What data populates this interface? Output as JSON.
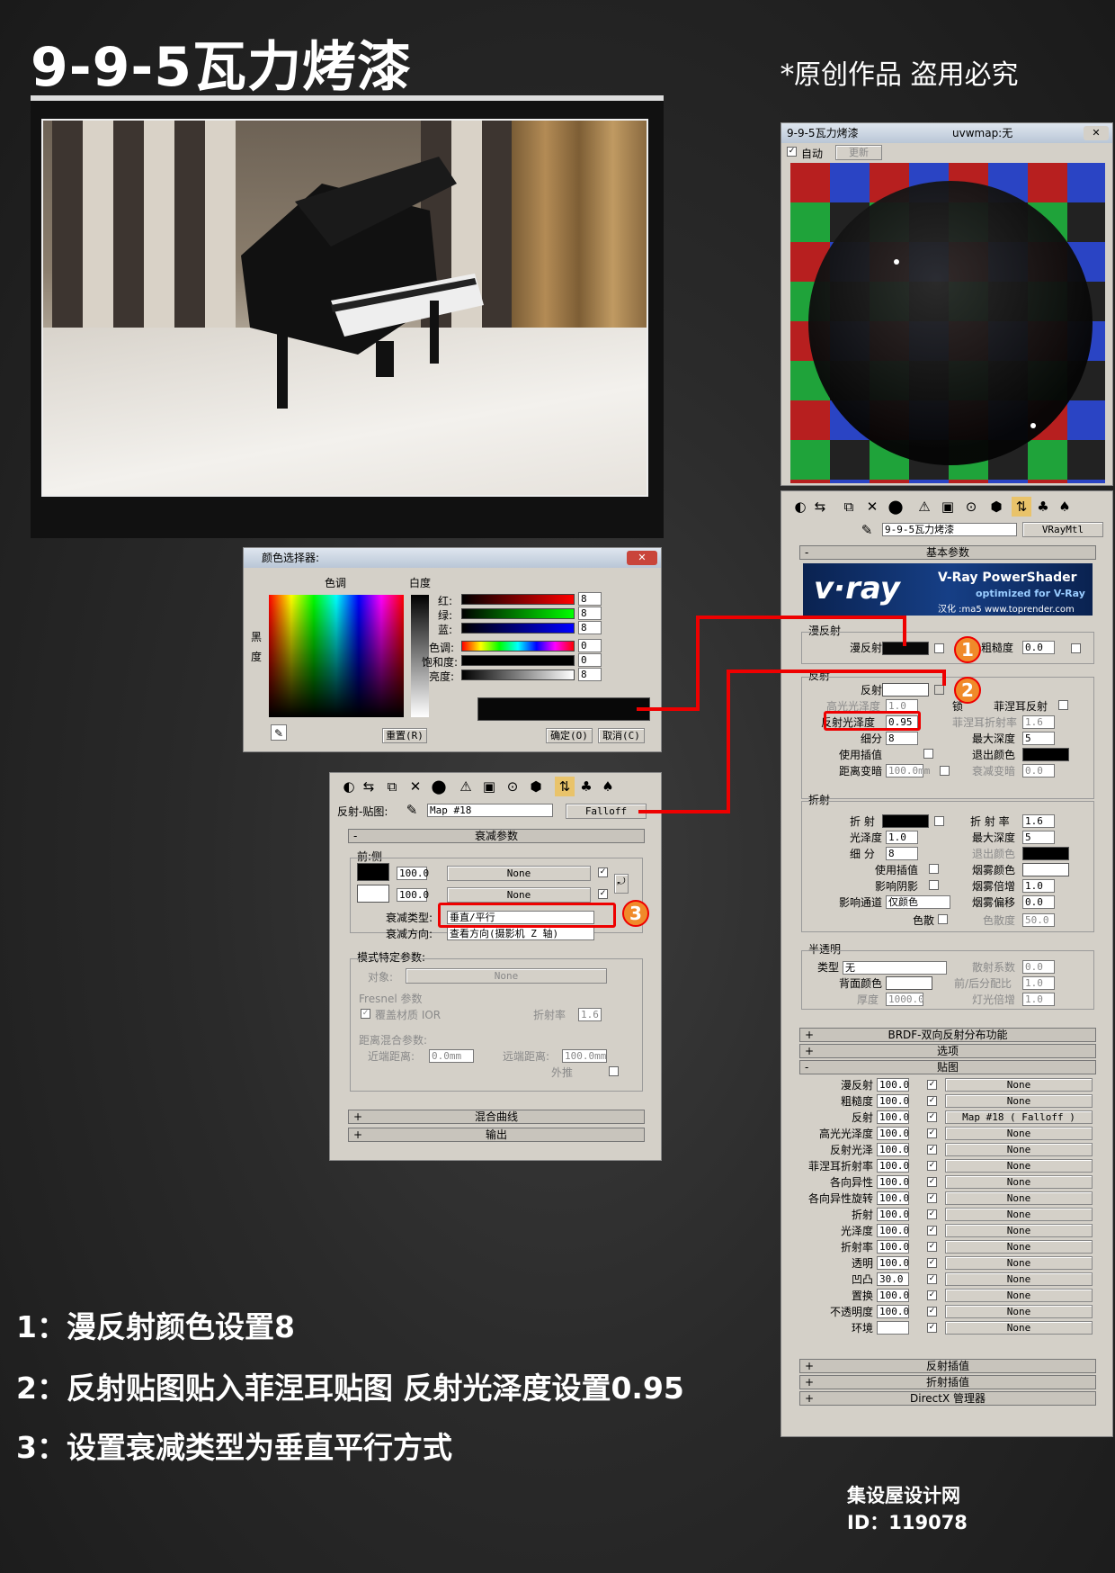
{
  "title": "9-9-5瓦力烤漆",
  "copyright": "*原创作品 盗用必究",
  "preview": {
    "title": "9-9-5瓦力烤漆",
    "map": "uvwmap:无",
    "auto": "自动",
    "update": "更新"
  },
  "color_picker": {
    "title": "颜色选择器:",
    "hue": "色调",
    "whiteness": "白度",
    "black": "黑",
    "degree": "度",
    "red": "红:",
    "green": "绿:",
    "blue": "蓝:",
    "hue2": "色调:",
    "sat": "饱和度:",
    "val": "亮度:",
    "red_v": "8",
    "green_v": "8",
    "blue_v": "8",
    "hue_v": "0",
    "sat_v": "0",
    "val_v": "8",
    "reset": "重置(R)",
    "ok": "确定(O)",
    "cancel": "取消(C)"
  },
  "falloff": {
    "label": "反射-贴图:",
    "map": "Map #18",
    "type": "Falloff",
    "rollout": "衰减参数",
    "front_side": "前:侧",
    "v1": "100.0",
    "v2": "100.0",
    "none": "None",
    "falloff_type_label": "衰减类型:",
    "falloff_type": "垂直/平行",
    "dir_label": "衰减方向:",
    "dir": "查看方向(摄影机 Z 轴)",
    "mode_params": "模式特定参数:",
    "object": "对象:",
    "fresnel": "Fresnel 参数",
    "override_ior": "覆盖材质 IOR",
    "ior": "折射率",
    "ior_v": "1.6",
    "dist_blend": "距离混合参数:",
    "near": "近端距离:",
    "near_v": "0.0mm",
    "far": "远端距离:",
    "far_v": "100.0mm",
    "extrap": "外推",
    "mix_curve": "混合曲线",
    "output": "输出"
  },
  "vray": {
    "material": "9-9-5瓦力烤漆",
    "type": "VRayMtl",
    "basic": "基本参数",
    "banner_logo": "v·ray",
    "banner_title": "V-Ray PowerShader",
    "banner_sub": "optimized for V-Ray",
    "banner_credit": "汉化 :ma5 www.toprender.com",
    "diffuse_grp": "漫反射",
    "diffuse": "漫反射",
    "rough": "粗糙度",
    "rough_v": "0.0",
    "refl_grp": "反射",
    "refl": "反射",
    "hilight": "高光光泽度",
    "hilight_v": "1.0",
    "lock": "锁",
    "fresnel": "菲涅耳反射",
    "refl_gloss": "反射光泽度",
    "refl_gloss_v": "0.95",
    "fresnel_ior": "菲涅耳折射率",
    "fresnel_ior_v": "1.6",
    "subdivs": "细分",
    "subdivs_v": "8",
    "max_depth": "最大深度",
    "max_depth_v": "5",
    "use_interp": "使用插值",
    "exit_color": "退出颜色",
    "dim_dist": "距离变暗",
    "dim_dist_v": "100.0mm",
    "dim_falloff": "衰减变暗",
    "dim_falloff_v": "0.0",
    "refr_grp": "折射",
    "refr": "折 射",
    "refr_ior": "折 射 率",
    "refr_ior_v": "1.6",
    "gloss": "光泽度",
    "gloss_v": "1.0",
    "r_max_depth": "最大深度",
    "r_max_depth_v": "5",
    "r_subdivs": "细 分",
    "r_subdivs_v": "8",
    "r_exit": "退出颜色",
    "r_use_interp": "使用插值",
    "fog_color": "烟雾颜色",
    "affect_shadows": "影响阴影",
    "fog_mult": "烟雾倍增",
    "fog_mult_v": "1.0",
    "affect_ch": "影响通道",
    "affect_ch_v": "仅颜色",
    "fog_bias": "烟雾偏移",
    "fog_bias_v": "0.0",
    "dispersion": "色散",
    "abbe": "色散度",
    "abbe_v": "50.0",
    "trans_grp": "半透明",
    "type_l": "类型",
    "type_v": "无",
    "scatter": "散射系数",
    "scatter_v": "0.0",
    "back_color": "背面颜色",
    "fb": "前/后分配比",
    "fb_v": "1.0",
    "thickness": "厚度",
    "thickness_v": "1000.0",
    "light_mult": "灯光倍增",
    "light_mult_v": "1.0",
    "brdf": "BRDF-双向反射分布功能",
    "options": "选项",
    "maps": "贴图",
    "map_rows": [
      {
        "name": "漫反射",
        "v": "100.0",
        "map": "None"
      },
      {
        "name": "粗糙度",
        "v": "100.0",
        "map": "None"
      },
      {
        "name": "反射",
        "v": "100.0",
        "map": "Map #18  ( Falloff )"
      },
      {
        "name": "高光光泽度",
        "v": "100.0",
        "map": "None"
      },
      {
        "name": "反射光泽",
        "v": "100.0",
        "map": "None"
      },
      {
        "name": "菲涅耳折射率",
        "v": "100.0",
        "map": "None"
      },
      {
        "name": "各向异性",
        "v": "100.0",
        "map": "None"
      },
      {
        "name": "各向异性旋转",
        "v": "100.0",
        "map": "None"
      },
      {
        "name": "折射",
        "v": "100.0",
        "map": "None"
      },
      {
        "name": "光泽度",
        "v": "100.0",
        "map": "None"
      },
      {
        "name": "折射率",
        "v": "100.0",
        "map": "None"
      },
      {
        "name": "透明",
        "v": "100.0",
        "map": "None"
      },
      {
        "name": "凹凸",
        "v": "30.0",
        "map": "None"
      },
      {
        "name": "置换",
        "v": "100.0",
        "map": "None"
      },
      {
        "name": "不透明度",
        "v": "100.0",
        "map": "None"
      },
      {
        "name": "环境",
        "v": "",
        "map": "None"
      }
    ],
    "refl_interp": "反射插值",
    "refr_interp": "折射插值",
    "directx": "DirectX 管理器"
  },
  "badges": [
    "1",
    "2",
    "3"
  ],
  "steps": [
    "1：漫反射颜色设置8",
    "2：反射贴图贴入菲涅耳贴图  反射光泽度设置0.95",
    "3：设置衰减类型为垂直平行方式"
  ],
  "footer": {
    "site": "集设屋设计网",
    "id": "ID：119078"
  }
}
